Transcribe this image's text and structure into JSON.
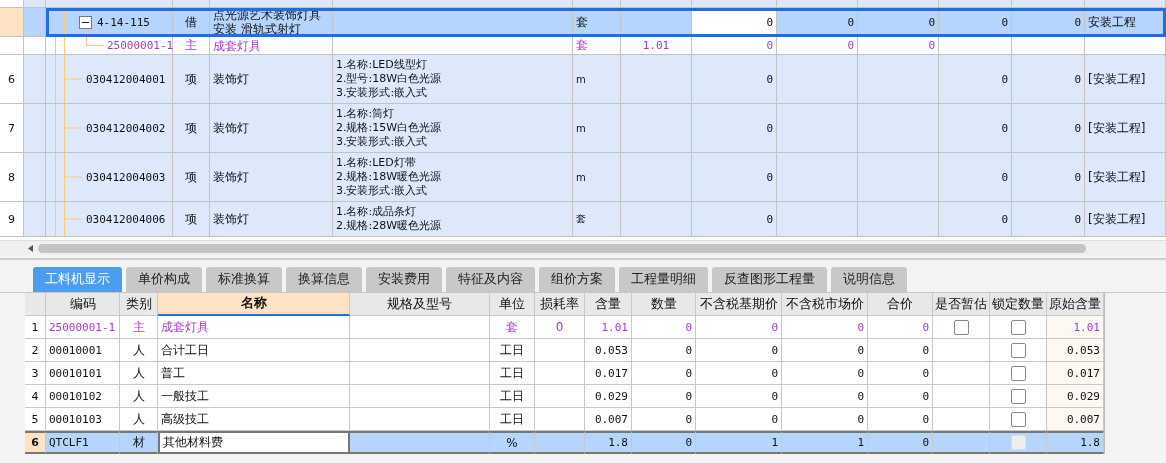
{
  "main_grid": {
    "rows": [
      {
        "code": "4-14-115",
        "type": "借",
        "name": "点光源艺术装饰灯具安装 滑轨式射灯",
        "unit": "套",
        "column_8": {
          "text": "0",
          "active": true
        },
        "column_9": "0",
        "column_10": "0",
        "column_11": "0",
        "column_12": "0",
        "column_13": "安装工程",
        "kind": "quota",
        "selected": true,
        "expanded": true,
        "children": [
          {
            "code": "25000001-1",
            "type": "主",
            "name": "成套灯具",
            "unit": "套",
            "column_7": "1.01",
            "column_8": "0",
            "column_9": "0",
            "column_10": "0",
            "kind": "main_material",
            "selected": false
          }
        ]
      },
      {
        "number": "6",
        "code": "030412004001",
        "type": "项",
        "name": "装饰灯",
        "spec": [
          "1.名称:LED线型灯",
          "2.型号:18W白色光源",
          "3.安装形式:嵌入式"
        ],
        "unit": "m",
        "column_8": "0",
        "column_11": "0",
        "column_12": "0",
        "column_13": "[安装工程]",
        "kind": "item",
        "selected": false
      },
      {
        "number": "7",
        "code": "030412004002",
        "type": "项",
        "name": "装饰灯",
        "spec": [
          "1.名称:筒灯",
          "2.规格:15W白色光源",
          "3.安装形式:嵌入式"
        ],
        "unit": "m",
        "column_8": "0",
        "column_11": "0",
        "column_12": "0",
        "column_13": "[安装工程]",
        "kind": "item",
        "selected": false
      },
      {
        "number": "8",
        "code": "030412004003",
        "type": "项",
        "name": "装饰灯",
        "spec": [
          "1.名称:LED灯带",
          "2.规格:18W暖色光源",
          "3.安装形式:嵌入式"
        ],
        "unit": "m",
        "column_8": "0",
        "column_11": "0",
        "column_12": "0",
        "column_13": "[安装工程]",
        "kind": "item",
        "selected": false
      },
      {
        "number": "9",
        "code": "030412004006",
        "type": "项",
        "name": "装饰灯",
        "spec": [
          "1.名称:成品条灯",
          "2.规格:28W暖色光源"
        ],
        "unit": "套",
        "column_8": "0",
        "column_11": "0",
        "column_12": "0",
        "column_13": "[安装工程]",
        "kind": "item",
        "selected": false
      }
    ]
  },
  "tabs": [
    {
      "label": "工料机显示",
      "selected": true
    },
    {
      "label": "单价构成",
      "selected": false
    },
    {
      "label": "标准换算",
      "selected": false
    },
    {
      "label": "换算信息",
      "selected": false
    },
    {
      "label": "安装费用",
      "selected": false
    },
    {
      "label": "特征及内容",
      "selected": false
    },
    {
      "label": "组价方案",
      "selected": false
    },
    {
      "label": "工程量明细",
      "selected": false
    },
    {
      "label": "反查图形工程量",
      "selected": false
    },
    {
      "label": "说明信息",
      "selected": false
    }
  ],
  "detail_grid": {
    "columns": [
      {
        "label": "编码",
        "selected": false
      },
      {
        "label": "类别",
        "selected": false
      },
      {
        "label": "名称",
        "selected": true
      },
      {
        "label": "规格及型号",
        "selected": false
      },
      {
        "label": "单位",
        "selected": false
      },
      {
        "label": "损耗率",
        "selected": false
      },
      {
        "label": "含量",
        "selected": false
      },
      {
        "label": "数量",
        "selected": false
      },
      {
        "label": "不含税基期价",
        "selected": false
      },
      {
        "label": "不含税市场价",
        "selected": false
      },
      {
        "label": "合价",
        "selected": false
      },
      {
        "label": "是否暂估",
        "selected": false
      },
      {
        "label": "锁定数量",
        "selected": false
      },
      {
        "label": "原始含量",
        "selected": false
      }
    ],
    "rows": [
      {
        "number": "1",
        "code": "25000001-1",
        "type": "主",
        "name": "成套灯具",
        "unit": "套",
        "loss_rate": "0",
        "content": "1.01",
        "quantity": "0",
        "base_price": "0",
        "market_price": "0",
        "total": "0",
        "provisional": {
          "checked": false
        },
        "locked": {
          "checked": false,
          "disabled": false
        },
        "original_content": "1.01",
        "kind": "main_material",
        "selected": false
      },
      {
        "number": "2",
        "code": "00010001",
        "type": "人",
        "name": "合计工日",
        "unit": "工日",
        "content": "0.053",
        "quantity": "0",
        "base_price": "0",
        "market_price": "0",
        "total": "0",
        "locked": {
          "checked": false,
          "disabled": false
        },
        "original_content": "0.053",
        "kind": "labor",
        "selected": false
      },
      {
        "number": "3",
        "code": "00010101",
        "type": "人",
        "name": "普工",
        "unit": "工日",
        "content": "0.017",
        "quantity": "0",
        "base_price": "0",
        "market_price": "0",
        "total": "0",
        "locked": {
          "checked": false,
          "disabled": false
        },
        "original_content": "0.017",
        "kind": "labor",
        "selected": false
      },
      {
        "number": "4",
        "code": "00010102",
        "type": "人",
        "name": "一般技工",
        "unit": "工日",
        "content": "0.029",
        "quantity": "0",
        "base_price": "0",
        "market_price": "0",
        "total": "0",
        "locked": {
          "checked": false,
          "disabled": false
        },
        "original_content": "0.029",
        "kind": "labor",
        "selected": false
      },
      {
        "number": "5",
        "code": "00010103",
        "type": "人",
        "name": "高级技工",
        "unit": "工日",
        "content": "0.007",
        "quantity": "0",
        "base_price": "0",
        "market_price": "0",
        "total": "0",
        "locked": {
          "checked": false,
          "disabled": false
        },
        "original_content": "0.007",
        "kind": "labor",
        "selected": false
      },
      {
        "number": "6",
        "code": "QTCLF1",
        "type": "材",
        "name": {
          "text": "其他材料费",
          "active": true
        },
        "unit": "%",
        "content": "1.8",
        "quantity": "0",
        "base_price": "1",
        "market_price": "1",
        "total": "0",
        "locked": {
          "checked": false,
          "disabled": true
        },
        "original_content": "1.8",
        "kind": "other",
        "selected": true
      }
    ]
  }
}
